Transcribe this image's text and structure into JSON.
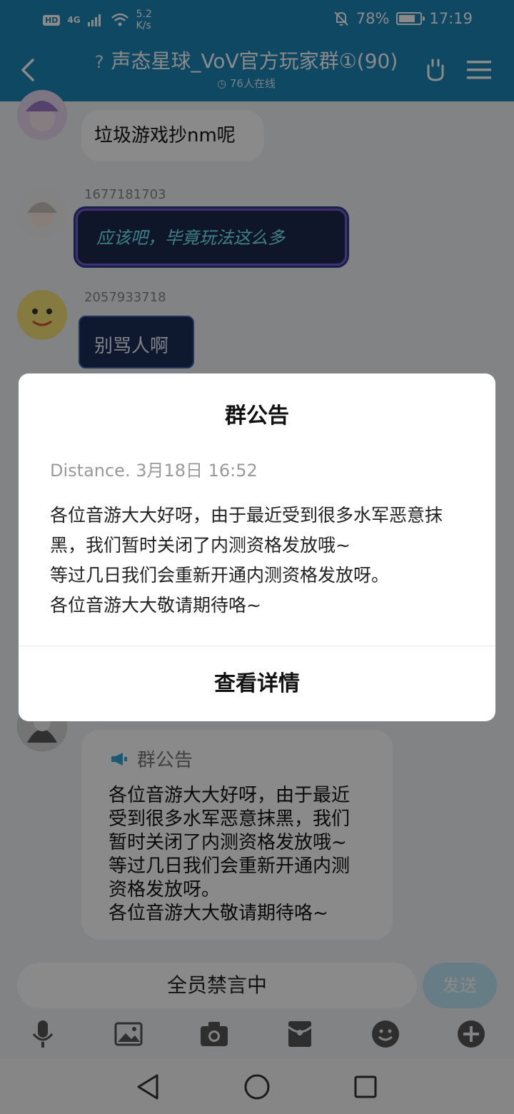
{
  "status": {
    "hd": "HD",
    "network": "4G",
    "speed_value": "5.2",
    "speed_unit": "K/s",
    "battery": "78%",
    "battery_level": 0.78,
    "time": "17:19"
  },
  "header": {
    "title": "声态星球_VoV官方玩家群①(90)",
    "online": "76人在线"
  },
  "messages": [
    {
      "text": "垃圾游戏抄nm呢"
    },
    {
      "sender": "1677181703",
      "text": "应该吧，毕竟玩法这么多"
    },
    {
      "sender": "2057933718",
      "text": "别骂人啊"
    }
  ],
  "announcement_card": {
    "title": "群公告",
    "lines": [
      "各位音游大大好呀，由于最近",
      "受到很多水军恶意抹黑，我们",
      "暂时关闭了内测资格发放哦~",
      "等过几日我们会重新开通内测",
      "资格发放呀。",
      "各位音游大大敬请期待咯~"
    ]
  },
  "composer": {
    "muted_text": "全员禁言中",
    "send_label": "发送"
  },
  "dialog": {
    "title": "群公告",
    "meta": "Distance. 3月18日 16:52",
    "lines": [
      "各位音游大大好呀，由于最近受到很多水军恶意抹",
      "黑，我们暂时关闭了内测资格发放哦~",
      "等过几日我们会重新开通内测资格发放呀。",
      "各位音游大大敬请期待咯~"
    ],
    "button": "查看详情"
  },
  "colors": {
    "header": "#1c86b7",
    "send_disabled": "#bfe7f6"
  },
  "icons": [
    "back-icon",
    "question-icon",
    "clock-icon",
    "hand-icon",
    "menu-icon",
    "mic-icon",
    "image-icon",
    "camera-icon",
    "redpacket-icon",
    "emoji-icon",
    "plus-icon",
    "nav-back-icon",
    "nav-home-icon",
    "nav-recent-icon"
  ]
}
